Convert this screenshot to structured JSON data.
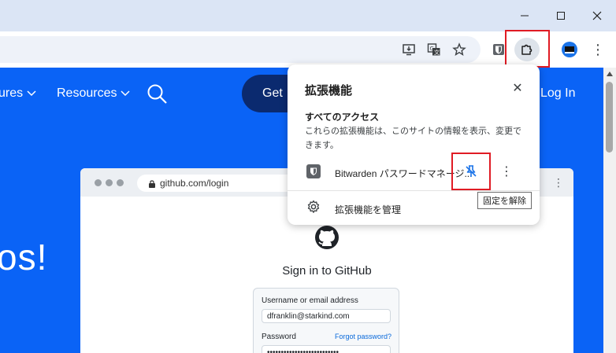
{
  "window": {
    "controls": {
      "minimize": "–",
      "maximize": "□",
      "close": "✕"
    }
  },
  "toolbar": {
    "icons": [
      "install-app-icon",
      "translate-icon",
      "bookmark-star-icon",
      "bitwarden-icon",
      "extensions-puzzle-icon",
      "profile-avatar-icon",
      "menu-kebab-icon"
    ],
    "more_menu": "⋮"
  },
  "site_nav": {
    "item1": "ures",
    "item2": "Resources",
    "get_button": "Get",
    "login": "Log In",
    "hero_text": "os!"
  },
  "mockup": {
    "url": "github.com/login",
    "heading": "Sign in to GitHub",
    "username_label": "Username or email address",
    "username_value": "dfranklin@starkind.com",
    "password_label": "Password",
    "forgot": "Forgot password?",
    "password_value": "••••••••••••••••••••••••••"
  },
  "extensions_popup": {
    "title": "拡張機能",
    "close": "✕",
    "section_title": "すべてのアクセス",
    "description": "これらの拡張機能は、このサイトの情報を表示、変更できます。",
    "extension_name": "Bitwarden パスワードマネージ...",
    "more": "⋮",
    "manage_label": "拡張機能を管理"
  },
  "tooltip": {
    "text": "固定を解除"
  },
  "colors": {
    "page_blue": "#0a63f6",
    "highlight_red": "#e01b24"
  }
}
